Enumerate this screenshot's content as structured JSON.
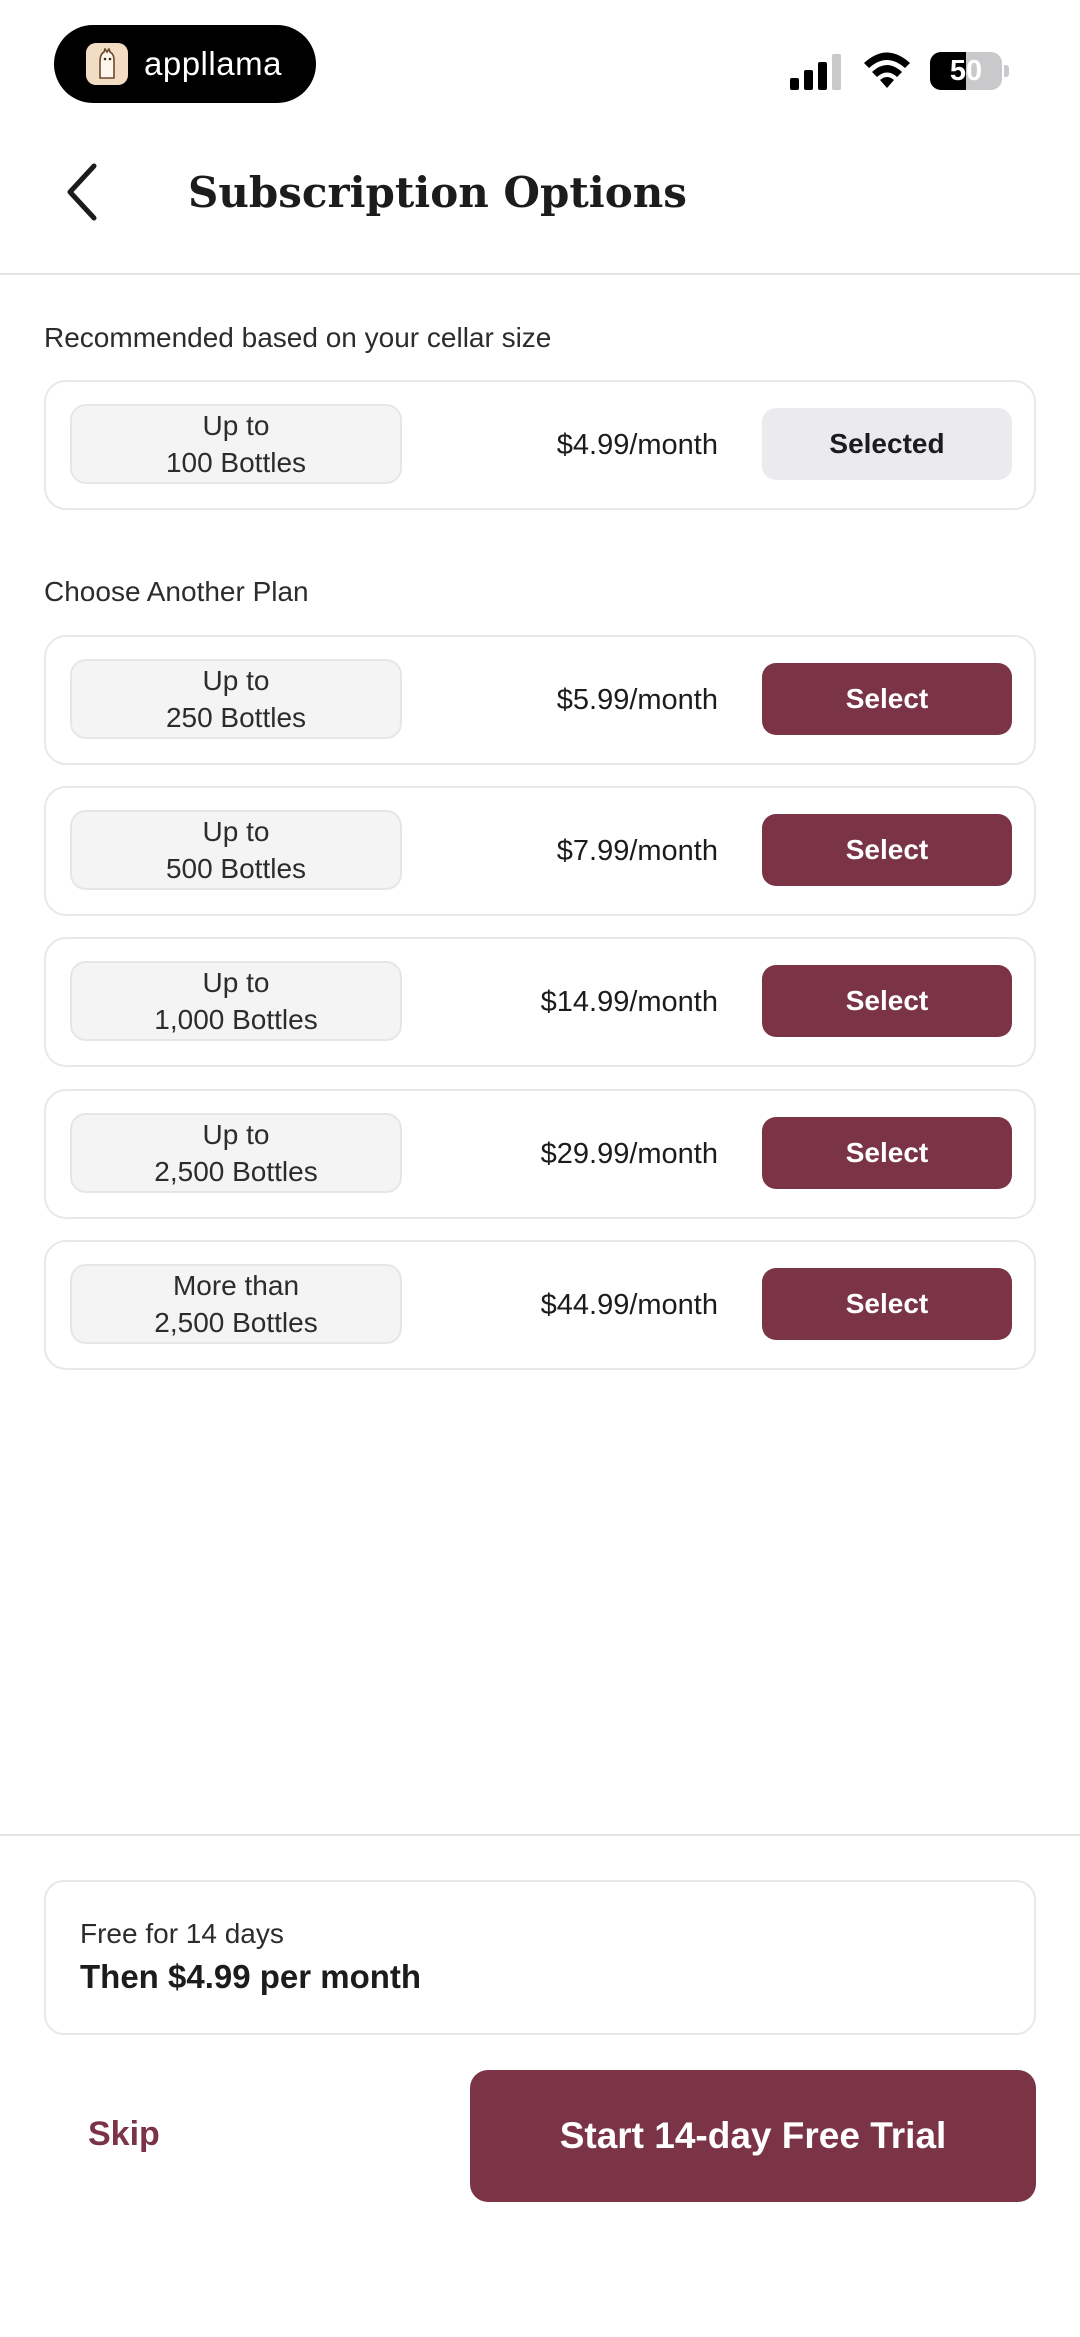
{
  "status_bar": {
    "app_name": "appllama",
    "logo_icon": "llama-icon",
    "battery_level": "50",
    "battery_fraction": 0.5,
    "signal_bars": 3
  },
  "nav": {
    "back_icon": "chevron-left-icon",
    "title": "Subscription Options"
  },
  "recommended": {
    "label": "Recommended based on your cellar size",
    "plan": {
      "line1": "Up to",
      "line2": "100 Bottles",
      "price": "$4.99/month",
      "button": "Selected"
    }
  },
  "other_plans": {
    "label": "Choose Another Plan",
    "plans": [
      {
        "line1": "Up to",
        "line2": "250 Bottles",
        "price": "$5.99/month",
        "button": "Select"
      },
      {
        "line1": "Up to",
        "line2": "500 Bottles",
        "price": "$7.99/month",
        "button": "Select"
      },
      {
        "line1": "Up to",
        "line2": "1,000 Bottles",
        "price": "$14.99/month",
        "button": "Select"
      },
      {
        "line1": "Up to",
        "line2": "2,500 Bottles",
        "price": "$29.99/month",
        "button": "Select"
      },
      {
        "line1": "More than",
        "line2": "2,500 Bottles",
        "price": "$44.99/month",
        "button": "Select"
      }
    ]
  },
  "footer": {
    "trial_line1": "Free for 14 days",
    "trial_line2": "Then $4.99 per month",
    "skip": "Skip",
    "start_button": "Start 14-day Free Trial"
  },
  "colors": {
    "accent": "#7b3446",
    "selected_bg": "#ebebed"
  }
}
